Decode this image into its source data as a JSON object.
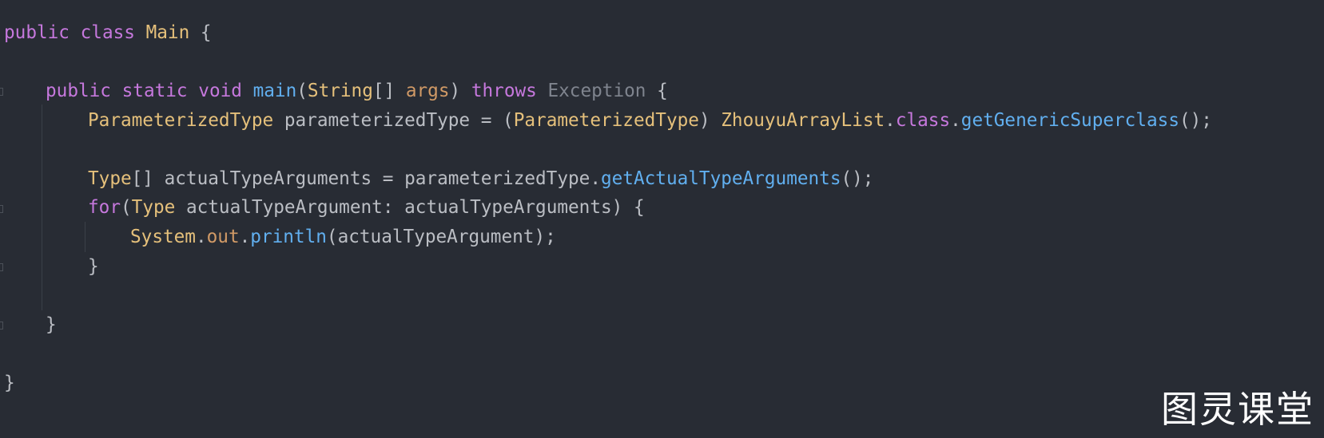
{
  "editor": {
    "lines": [
      {
        "id": "l1",
        "tokens": {
          "kw_public": "public",
          "kw_class": "class",
          "class_name": "Main",
          "brace": " {"
        }
      },
      {
        "id": "l3",
        "tokens": {
          "kw_public": "public",
          "kw_static": "static",
          "kw_void": "void",
          "method": "main",
          "open": "(",
          "type_string": "String",
          "arr": "[] ",
          "param": "args",
          "close": ")",
          "kw_throws": "throws",
          "exc": "Exception",
          "brace": " {"
        }
      },
      {
        "id": "l4",
        "tokens": {
          "type1": "ParameterizedType",
          "var": " parameterizedType = (",
          "type2": "ParameterizedType",
          "cast_close": ") ",
          "cls": "ZhouyuArrayList",
          "dot": ".",
          "kw_class": "class",
          "dot2": ".",
          "call": "getGenericSuperclass",
          "end": "();"
        }
      },
      {
        "id": "l6",
        "tokens": {
          "type": "Type",
          "rest": "[] actualTypeArguments = parameterizedType.",
          "call": "getActualTypeArguments",
          "end": "();"
        }
      },
      {
        "id": "l7",
        "tokens": {
          "kw_for": "for",
          "open": "(",
          "type": "Type",
          "rest": " actualTypeArgument: actualTypeArguments) {"
        }
      },
      {
        "id": "l8",
        "tokens": {
          "sys": "System",
          "dot": ".",
          "out": "out",
          "dot2": ".",
          "call": "println",
          "rest": "(actualTypeArgument);"
        }
      },
      {
        "id": "l9",
        "tokens": {
          "brace": "}"
        }
      },
      {
        "id": "l11",
        "tokens": {
          "brace": "}"
        }
      },
      {
        "id": "l13",
        "tokens": {
          "brace": "}"
        }
      }
    ]
  },
  "watermark": "图灵课堂",
  "colors": {
    "background": "#282c34",
    "keyword": "#c678dd",
    "type": "#e5c07b",
    "function": "#61afef",
    "parameter": "#d19a66",
    "plain": "#bbbec4",
    "dim": "#7f848e"
  }
}
